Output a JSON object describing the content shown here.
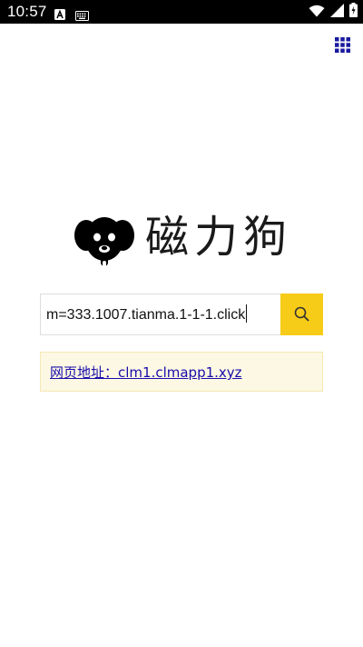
{
  "status_bar": {
    "time": "10:57",
    "left_icons": [
      "a-icon",
      "keyboard-icon"
    ],
    "right_icons": [
      "wifi-icon",
      "signal-icon",
      "battery-icon"
    ]
  },
  "header": {
    "menu_icon": "grid-menu-icon",
    "menu_icon_color": "#1a1aa0"
  },
  "logo": {
    "text": "磁力狗",
    "icon": "dog-logo-icon"
  },
  "search": {
    "value": "m=333.1007.tianma.1-1-1.click",
    "button_icon": "search-icon",
    "button_color": "#f7cc18"
  },
  "notice": {
    "link_text": "网页地址：clm1.clmapp1.xyz",
    "background": "#fcf8e3",
    "link_color": "#1a0dab"
  }
}
